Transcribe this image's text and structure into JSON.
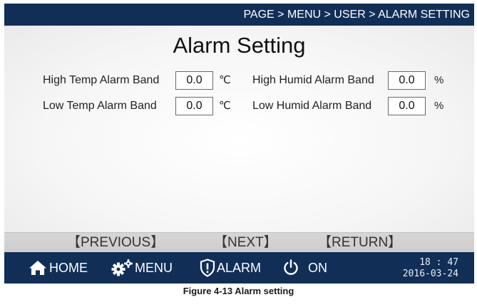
{
  "header": {
    "breadcrumb": "PAGE > MENU > USER > ALARM SETTING"
  },
  "page": {
    "title": "Alarm Setting"
  },
  "settings": {
    "high_temp": {
      "label": "High Temp Alarm Band",
      "value": "0.0",
      "unit": "℃"
    },
    "low_temp": {
      "label": "Low Temp Alarm Band",
      "value": "0.0",
      "unit": "℃"
    },
    "high_humid": {
      "label": "High Humid Alarm Band",
      "value": "0.0",
      "unit": "%"
    },
    "low_humid": {
      "label": "Low Humid Alarm Band",
      "value": "0.0",
      "unit": "%"
    }
  },
  "nav": {
    "previous": "【PREVIOUS】",
    "next": "【NEXT】",
    "return": "【RETURN】"
  },
  "bottombar": {
    "home": "HOME",
    "menu": "MENU",
    "alarm": "ALARM",
    "power": "ON",
    "time": "18 : 47",
    "date": "2016-03-24"
  },
  "caption": "Figure 4-13 Alarm setting",
  "colors": {
    "bar": "#112f56",
    "background": "#e9e9e9"
  }
}
